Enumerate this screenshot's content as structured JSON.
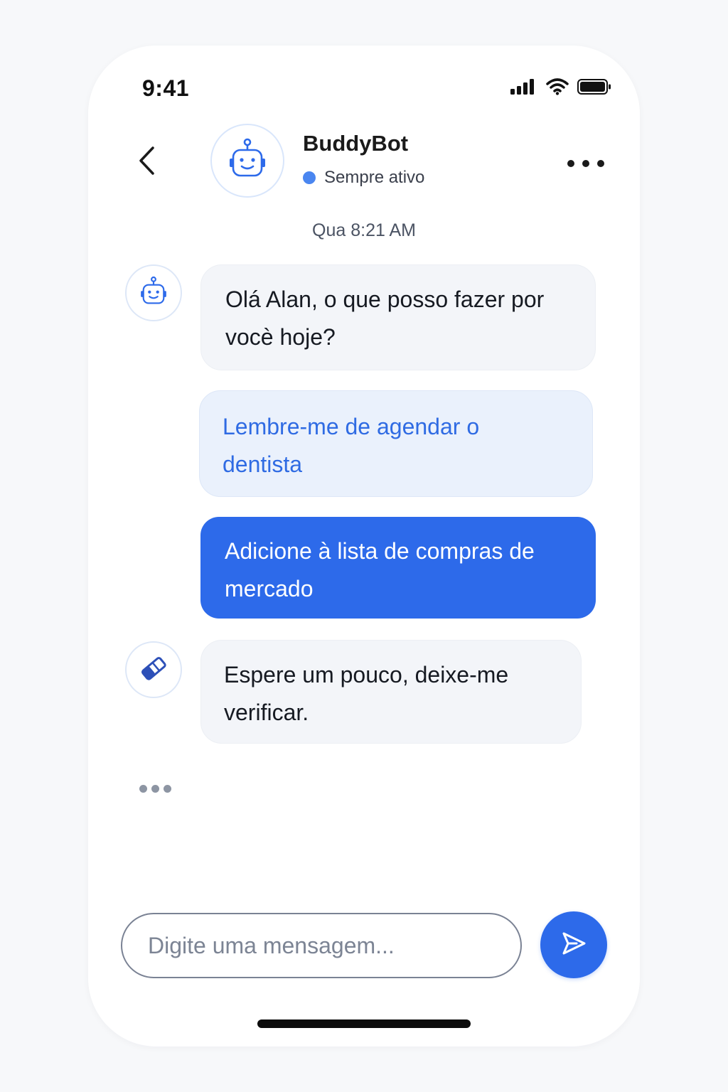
{
  "status_bar": {
    "time": "9:41",
    "icons": [
      "signal-icon",
      "wifi-icon",
      "battery-icon"
    ]
  },
  "header": {
    "back_icon": "chevron-left-icon",
    "avatar_icon": "robot-icon",
    "name": "BuddyBot",
    "status_text": "Sempre ativo",
    "status_color": "#4a86f0",
    "more_icon": "more-horizontal-icon"
  },
  "conversation": {
    "timestamp": "Qua 8:21 AM",
    "bot_message_1": "Olá Alan, o que posso fazer por vocè hoje?",
    "suggestion": "Lembre-me de agendar o dentista",
    "user_message": "Adicione à lista de compras de mercado",
    "bot_message_2": "Espere um pouco, deixe-me verificar.",
    "bot_message_2_icon": "eraser-icon",
    "typing_indicator_icon": "typing-dots-icon"
  },
  "composer": {
    "placeholder": "Digite uma mensagem...",
    "send_icon": "send-icon"
  },
  "colors": {
    "accent": "#2d6aea",
    "suggestion_bg": "#eaf1fc",
    "suggestion_text": "#2f6be3",
    "bot_bubble_bg": "#f3f5f9"
  }
}
